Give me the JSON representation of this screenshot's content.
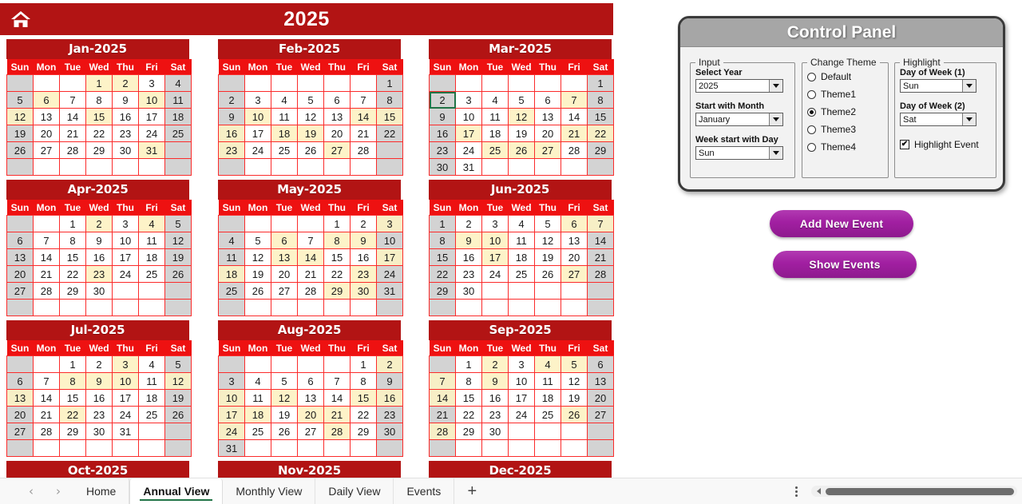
{
  "banner": {
    "home_icon": "home-icon",
    "year_title": "2025"
  },
  "weekday_headers": [
    "Sun",
    "Mon",
    "Tue",
    "Wed",
    "Thu",
    "Fri",
    "Sat"
  ],
  "months": [
    {
      "title": "Jan-2025",
      "weeks": [
        [
          null,
          null,
          null,
          1,
          2,
          3,
          4
        ],
        [
          5,
          6,
          7,
          8,
          9,
          10,
          11
        ],
        [
          12,
          13,
          14,
          15,
          16,
          17,
          18
        ],
        [
          19,
          20,
          21,
          22,
          23,
          24,
          25
        ],
        [
          26,
          27,
          28,
          29,
          30,
          31,
          null
        ],
        [
          null,
          null,
          null,
          null,
          null,
          null,
          null
        ]
      ],
      "highlight": [
        1,
        2,
        6,
        10,
        12,
        15,
        31
      ]
    },
    {
      "title": "Feb-2025",
      "weeks": [
        [
          null,
          null,
          null,
          null,
          null,
          null,
          1
        ],
        [
          2,
          3,
          4,
          5,
          6,
          7,
          8
        ],
        [
          9,
          10,
          11,
          12,
          13,
          14,
          15
        ],
        [
          16,
          17,
          18,
          19,
          20,
          21,
          22
        ],
        [
          23,
          24,
          25,
          26,
          27,
          28,
          null
        ],
        [
          null,
          null,
          null,
          null,
          null,
          null,
          null
        ]
      ],
      "highlight": [
        10,
        14,
        15,
        16,
        18,
        19,
        23,
        27
      ]
    },
    {
      "title": "Mar-2025",
      "weeks": [
        [
          null,
          null,
          null,
          null,
          null,
          null,
          1
        ],
        [
          2,
          3,
          4,
          5,
          6,
          7,
          8
        ],
        [
          9,
          10,
          11,
          12,
          13,
          14,
          15
        ],
        [
          16,
          17,
          18,
          19,
          20,
          21,
          22
        ],
        [
          23,
          24,
          25,
          26,
          27,
          28,
          29
        ],
        [
          30,
          31,
          null,
          null,
          null,
          null,
          null
        ]
      ],
      "highlight": [
        7,
        12,
        17,
        21,
        22,
        25,
        26,
        27
      ],
      "selected": 2
    },
    {
      "title": "Apr-2025",
      "weeks": [
        [
          null,
          null,
          1,
          2,
          3,
          4,
          5
        ],
        [
          6,
          7,
          8,
          9,
          10,
          11,
          12
        ],
        [
          13,
          14,
          15,
          16,
          17,
          18,
          19
        ],
        [
          20,
          21,
          22,
          23,
          24,
          25,
          26
        ],
        [
          27,
          28,
          29,
          30,
          null,
          null,
          null
        ],
        [
          null,
          null,
          null,
          null,
          null,
          null,
          null
        ]
      ],
      "highlight": [
        2,
        4,
        23
      ]
    },
    {
      "title": "May-2025",
      "weeks": [
        [
          null,
          null,
          null,
          null,
          1,
          2,
          3
        ],
        [
          4,
          5,
          6,
          7,
          8,
          9,
          10
        ],
        [
          11,
          12,
          13,
          14,
          15,
          16,
          17
        ],
        [
          18,
          19,
          20,
          21,
          22,
          23,
          24
        ],
        [
          25,
          26,
          27,
          28,
          29,
          30,
          31
        ],
        [
          null,
          null,
          null,
          null,
          null,
          null,
          null
        ]
      ],
      "highlight": [
        3,
        6,
        8,
        9,
        13,
        14,
        17,
        18,
        23,
        29,
        30
      ]
    },
    {
      "title": "Jun-2025",
      "weeks": [
        [
          1,
          2,
          3,
          4,
          5,
          6,
          7
        ],
        [
          8,
          9,
          10,
          11,
          12,
          13,
          14
        ],
        [
          15,
          16,
          17,
          18,
          19,
          20,
          21
        ],
        [
          22,
          23,
          24,
          25,
          26,
          27,
          28
        ],
        [
          29,
          30,
          null,
          null,
          null,
          null,
          null
        ],
        [
          null,
          null,
          null,
          null,
          null,
          null,
          null
        ]
      ],
      "highlight": [
        6,
        7,
        9,
        10,
        17,
        27
      ]
    },
    {
      "title": "Jul-2025",
      "weeks": [
        [
          null,
          null,
          1,
          2,
          3,
          4,
          5
        ],
        [
          6,
          7,
          8,
          9,
          10,
          11,
          12
        ],
        [
          13,
          14,
          15,
          16,
          17,
          18,
          19
        ],
        [
          20,
          21,
          22,
          23,
          24,
          25,
          26
        ],
        [
          27,
          28,
          29,
          30,
          31,
          null,
          null
        ],
        [
          null,
          null,
          null,
          null,
          null,
          null,
          null
        ]
      ],
      "highlight": [
        3,
        8,
        9,
        10,
        12,
        13,
        22
      ]
    },
    {
      "title": "Aug-2025",
      "weeks": [
        [
          null,
          null,
          null,
          null,
          null,
          1,
          2
        ],
        [
          3,
          4,
          5,
          6,
          7,
          8,
          9
        ],
        [
          10,
          11,
          12,
          13,
          14,
          15,
          16
        ],
        [
          17,
          18,
          19,
          20,
          21,
          22,
          23
        ],
        [
          24,
          25,
          26,
          27,
          28,
          29,
          30
        ],
        [
          31,
          null,
          null,
          null,
          null,
          null,
          null
        ]
      ],
      "highlight": [
        2,
        10,
        12,
        15,
        16,
        17,
        18,
        20,
        21,
        24,
        28
      ]
    },
    {
      "title": "Sep-2025",
      "weeks": [
        [
          null,
          1,
          2,
          3,
          4,
          5,
          6
        ],
        [
          7,
          8,
          9,
          10,
          11,
          12,
          13
        ],
        [
          14,
          15,
          16,
          17,
          18,
          19,
          20
        ],
        [
          21,
          22,
          23,
          24,
          25,
          26,
          27
        ],
        [
          28,
          29,
          30,
          null,
          null,
          null,
          null
        ],
        [
          null,
          null,
          null,
          null,
          null,
          null,
          null
        ]
      ],
      "highlight": [
        2,
        4,
        5,
        7,
        9,
        14,
        26,
        28
      ]
    },
    {
      "title": "Oct-2025",
      "weeks": [],
      "highlight": []
    },
    {
      "title": "Nov-2025",
      "weeks": [],
      "highlight": []
    },
    {
      "title": "Dec-2025",
      "weeks": [],
      "highlight": []
    }
  ],
  "control_panel": {
    "title": "Control Panel",
    "input_group": {
      "legend": "Input",
      "select_year_label": "Select Year",
      "select_year_value": "2025",
      "start_month_label": "Start with Month",
      "start_month_value": "January",
      "week_start_label": "Week start with Day",
      "week_start_value": "Sun"
    },
    "theme_group": {
      "legend": "Change Theme",
      "options": [
        "Default",
        "Theme1",
        "Theme2",
        "Theme3",
        "Theme4"
      ],
      "selected": "Theme2"
    },
    "highlight_group": {
      "legend": "Highlight",
      "dow1_label": "Day of Week (1)",
      "dow1_value": "Sun",
      "dow2_label": "Day of Week (2)",
      "dow2_value": "Sat",
      "highlight_event_label": "Highlight Event",
      "highlight_event_checked": true,
      "check_glyph": "✔"
    }
  },
  "actions": {
    "add_new_event": "Add New Event",
    "show_events": "Show Events"
  },
  "bottom_bar": {
    "prev_arrow": "‹",
    "next_arrow": "›",
    "tabs": [
      {
        "label": "Home",
        "active": false
      },
      {
        "label": "Annual View",
        "active": true
      },
      {
        "label": "Monthly View",
        "active": false
      },
      {
        "label": "Daily View",
        "active": false
      },
      {
        "label": "Events",
        "active": false
      }
    ],
    "add_sheet": "+"
  },
  "colors": {
    "banner_red": "#b21414",
    "header_red": "#ee1111",
    "cell_border": "#fb2b2b",
    "weekend_gray": "#d3d3d3",
    "highlight_yellow": "#fdf3c8",
    "panel_title_gray": "#a6a6a6",
    "button_purple": "#a11fa1",
    "active_tab_green": "#217346"
  }
}
